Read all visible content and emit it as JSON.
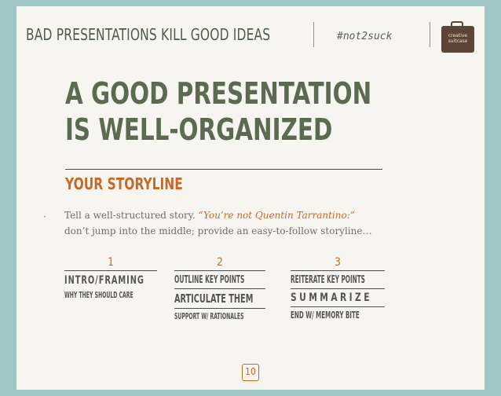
{
  "header": {
    "title": "BAD PRESENTATIONS KILL GOOD IDEAS",
    "hashtag": "#not2suck",
    "logo_text": [
      "creative",
      "suitcase"
    ]
  },
  "slide": {
    "headline": [
      "A GOOD PRESENTATION",
      "IS WELL-ORGANIZED"
    ],
    "subhead": "YOUR STORYLINE",
    "bullet": {
      "text_before": "Tell a well-structured story. ",
      "quote": "“You’re not Quentin Tarrantino:”",
      "line2": "don’t jump into the middle; provide an easy-to-follow storyline…"
    },
    "columns": [
      {
        "number": "1",
        "lines": [
          "INTRO/FRAMING",
          "WHY THEY SHOULD CARE"
        ]
      },
      {
        "number": "2",
        "lines": [
          "OUTLINE KEY POINTS",
          "ARTICULATE THEM",
          "SUPPORT W/ RATIONALES"
        ]
      },
      {
        "number": "3",
        "lines": [
          "REITERATE KEY POINTS",
          "SUMMARIZE",
          "END W/ MEMORY BITE"
        ]
      }
    ],
    "page_number": "10"
  },
  "colors": {
    "background": "#9fc5c6",
    "slide": "#f7f5ef",
    "olive": "#5d6a52",
    "accent": "#c8692a",
    "logo": "#5c4538"
  }
}
